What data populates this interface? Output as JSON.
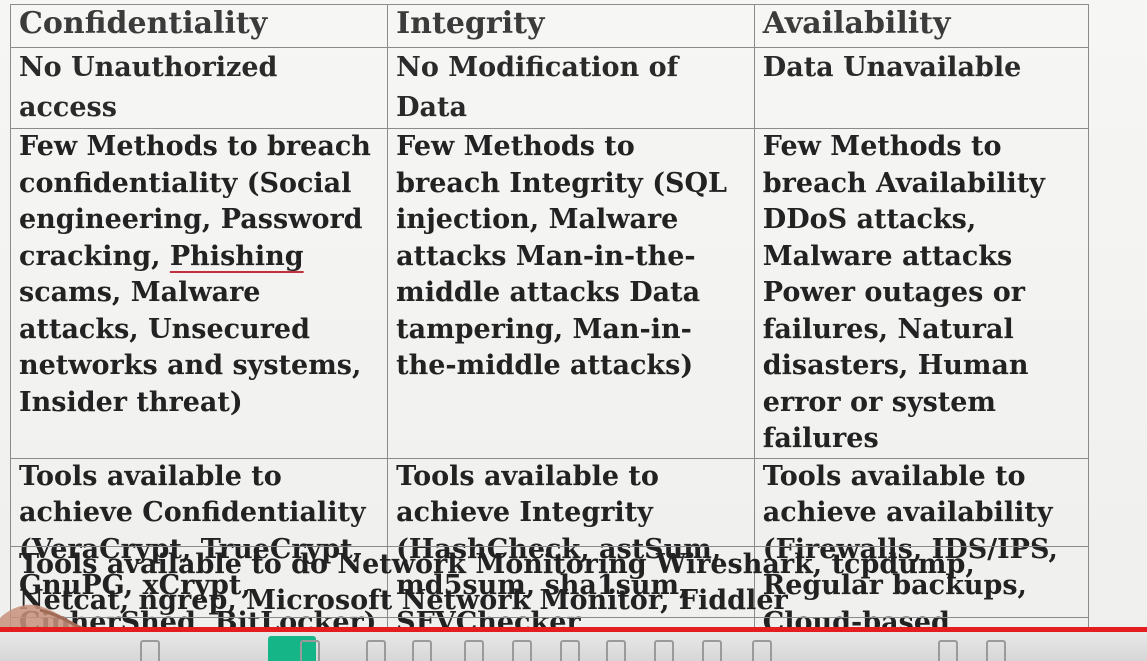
{
  "table": {
    "headers": [
      "Confidentiality",
      "Integrity",
      "Availability"
    ],
    "definitions": [
      "No Unauthorized access",
      "No Modification of Data",
      "Data Unavailable"
    ],
    "breach": {
      "confidentiality_before": "Few Methods to breach confidentiality (Social engineering, Password cracking, ",
      "confidentiality_underlined": "Phishing",
      "confidentiality_after": " scams, Malware attacks, Unsecured networks and systems, Insider threat)",
      "integrity": "Few Methods to breach Integrity (SQL injection, Malware attacks Man-in-the-middle attacks Data tampering, Man-in-the-middle attacks)",
      "availability": "Few Methods to breach Availability DDoS attacks, Malware attacks Power outages or failures, Natural disasters, Human error or system failures"
    },
    "tools": [
      "Tools available to achieve Confidentiality (VeraCrypt, TrueCrypt, GnuPG, xCrypt, CipherShed, BitLocker)",
      "Tools available to achieve Integrity (HashCheck, astSum, md5sum, sha1sum, SFVChecker, QuickSFV)",
      "Tools available to achieve availability (Firewalls, IDS/IPS, Regular backups, Cloud-based solutions)"
    ],
    "network_monitoring": "Tools available to do Network Monitoring Wireshark, tcpdump, Netcat, ngrep, Microsoft Network Monitor, Fiddler"
  },
  "video": {
    "progress_percent": 100,
    "progress_color": "#e41e1e",
    "toolbar_icons": [
      "chevron-icon",
      "pen-icon",
      "eraser-icon",
      "text-icon",
      "shape-icon",
      "undo-icon",
      "grid-icon",
      "layers-icon",
      "table-icon",
      "chart-icon",
      "note-icon",
      "arrow-icon",
      "clock-icon",
      "check-icon"
    ]
  },
  "colors": {
    "active_tool": "#15b587",
    "underline": "#c0303f"
  }
}
